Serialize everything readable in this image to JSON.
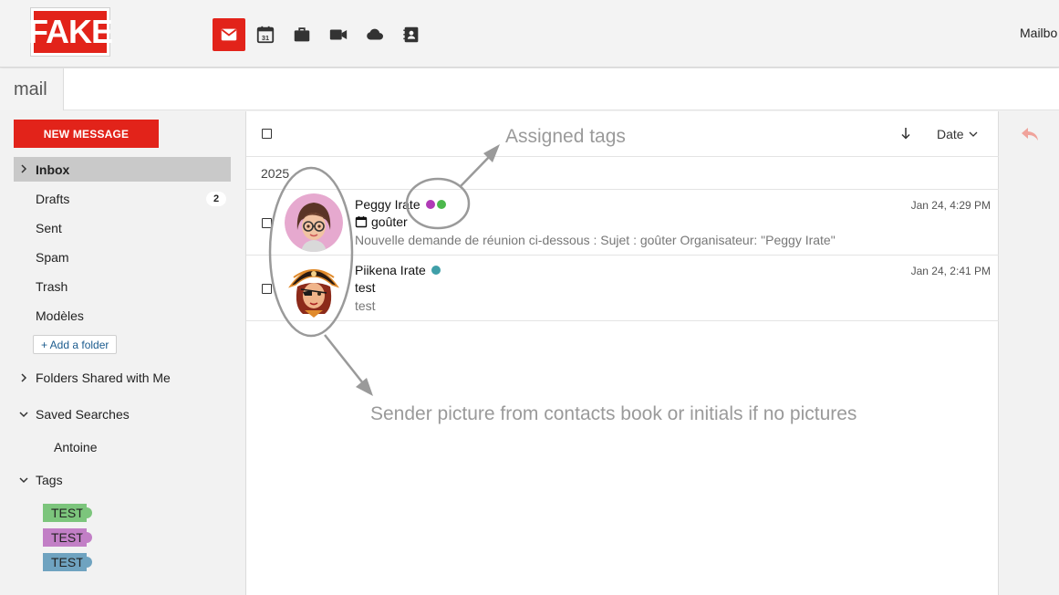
{
  "header": {
    "logo_text": "FAKE",
    "apps": [
      {
        "name": "mail-icon",
        "active": true
      },
      {
        "name": "calendar-icon",
        "day": "31"
      },
      {
        "name": "briefcase-icon"
      },
      {
        "name": "video-icon"
      },
      {
        "name": "cloud-icon"
      },
      {
        "name": "contacts-icon"
      }
    ],
    "mailbox_label": "Mailbo",
    "accent": "#e2231a"
  },
  "subbar": {
    "title": "mail"
  },
  "sidebar": {
    "new_message": "NEW MESSAGE",
    "folders": [
      {
        "label": "Inbox",
        "active": true
      },
      {
        "label": "Drafts",
        "count": "2"
      },
      {
        "label": "Sent"
      },
      {
        "label": "Spam"
      },
      {
        "label": "Trash"
      },
      {
        "label": "Modèles"
      }
    ],
    "add_folder": "+ Add a folder",
    "shared": "Folders Shared with Me",
    "saved_searches": "Saved Searches",
    "saved_search_items": [
      "Antoine"
    ],
    "tags_title": "Tags",
    "tags": [
      {
        "label": "TEST",
        "color": "#7cc57c"
      },
      {
        "label": "TEST",
        "color": "#c27fc6"
      },
      {
        "label": "TEST",
        "color": "#6fa3c0"
      }
    ]
  },
  "list": {
    "sort_label": "Date",
    "year": "2025",
    "messages": [
      {
        "sender": "Peggy Irate",
        "tag_colors": [
          "#b03ab6",
          "#4cb84c"
        ],
        "subject": "goûter",
        "has_calendar_icon": true,
        "preview": "Nouvelle demande de réunion ci-dessous : Sujet : goûter Organisateur: \"Peggy Irate\"",
        "date": "Jan 24, 4:29 PM"
      },
      {
        "sender": "Piikena Irate",
        "tag_colors": [
          "#3f9fa8"
        ],
        "subject": "test",
        "has_calendar_icon": false,
        "preview": "test",
        "date": "Jan 24, 2:41 PM"
      }
    ]
  },
  "annotations": {
    "tags_note": "Assigned tags",
    "avatar_note": "Sender picture from contacts book or initials if no pictures"
  }
}
